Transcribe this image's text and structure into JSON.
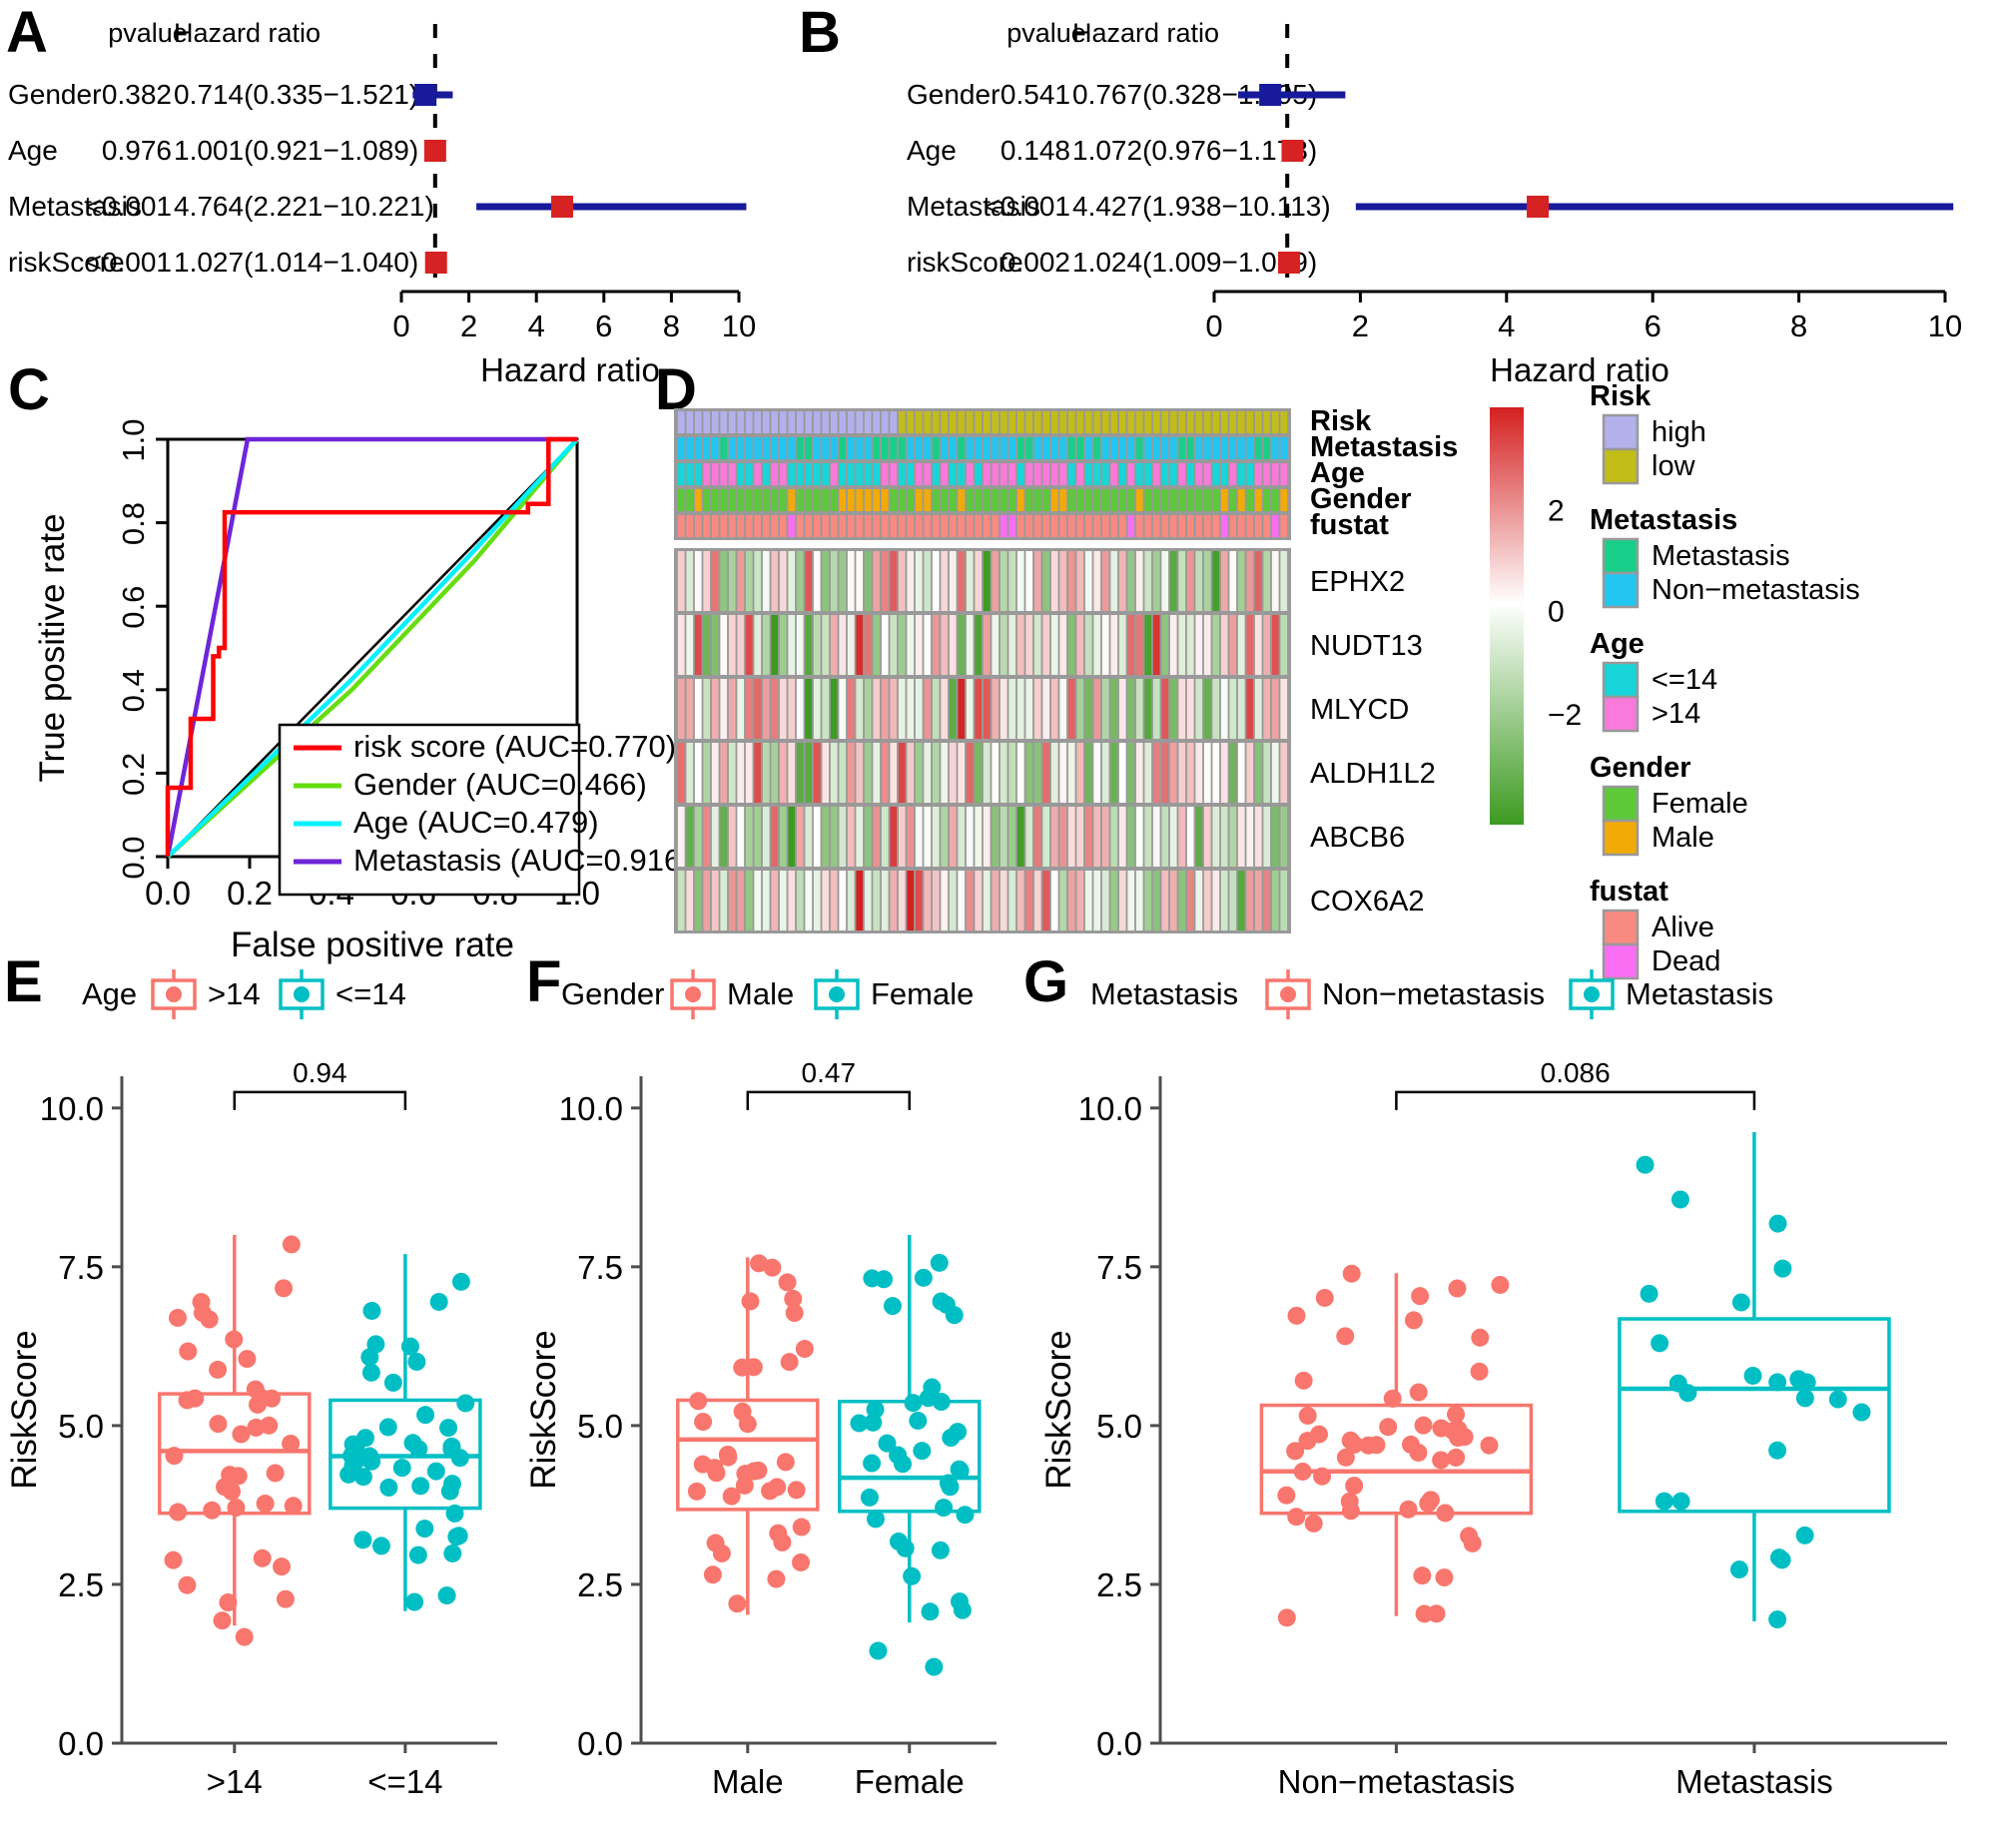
{
  "panels": {
    "A": {
      "label": "A"
    },
    "B": {
      "label": "B"
    },
    "C": {
      "label": "C"
    },
    "D": {
      "label": "D"
    },
    "E": {
      "label": "E"
    },
    "F": {
      "label": "F"
    },
    "G": {
      "label": "G"
    }
  },
  "forest": {
    "headers": {
      "pvalue": "pvalue",
      "hr": "Hazard ratio"
    },
    "axis_title": "Hazard ratio",
    "ticks": [
      "0",
      "2",
      "4",
      "6",
      "8",
      "10"
    ],
    "colors": {
      "red": "#d62222",
      "blue": "#181a9c",
      "dashed": "#000000"
    },
    "A": {
      "rows": [
        {
          "name": "Gender",
          "pvalue": "0.382",
          "hr": "0.714(0.335−1.521)",
          "est": 0.714,
          "lo": 0.335,
          "hi": 1.521,
          "box": "blue"
        },
        {
          "name": "Age",
          "pvalue": "0.976",
          "hr": "1.001(0.921−1.089)",
          "est": 1.001,
          "lo": 0.921,
          "hi": 1.089,
          "box": "red"
        },
        {
          "name": "Metastasis",
          "pvalue": "<0.001",
          "hr": "4.764(2.221−10.221)",
          "est": 4.764,
          "lo": 2.221,
          "hi": 10.221,
          "box": "red"
        },
        {
          "name": "riskScore",
          "pvalue": "<0.001",
          "hr": "1.027(1.014−1.040)",
          "est": 1.027,
          "lo": 1.014,
          "hi": 1.04,
          "box": "red"
        }
      ]
    },
    "B": {
      "rows": [
        {
          "name": "Gender",
          "pvalue": "0.541",
          "hr": "0.767(0.328−1.795)",
          "est": 0.767,
          "lo": 0.328,
          "hi": 1.795,
          "box": "blue"
        },
        {
          "name": "Age",
          "pvalue": "0.148",
          "hr": "1.072(0.976−1.178)",
          "est": 1.072,
          "lo": 0.976,
          "hi": 1.178,
          "box": "red"
        },
        {
          "name": "Metastasis",
          "pvalue": "<0.001",
          "hr": "4.427(1.938−10.113)",
          "est": 4.427,
          "lo": 1.938,
          "hi": 10.113,
          "box": "red"
        },
        {
          "name": "riskScore",
          "pvalue": "0.002",
          "hr": "1.024(1.009−1.039)",
          "est": 1.024,
          "lo": 1.009,
          "hi": 1.039,
          "box": "red"
        }
      ]
    }
  },
  "chart_data": [
    {
      "type": "line",
      "panel": "C",
      "title": "",
      "xlabel": "False positive rate",
      "ylabel": "True positive rate",
      "xlim": [
        0,
        1
      ],
      "ylim": [
        0,
        1
      ],
      "xticks": [
        "0.0",
        "0.2",
        "0.4",
        "0.6",
        "0.8",
        "1.0"
      ],
      "yticks": [
        "0.0",
        "0.2",
        "0.4",
        "0.6",
        "0.8",
        "1.0"
      ],
      "grid": false,
      "legend_position": "bottom-right",
      "series": [
        {
          "name": "risk score (AUC=0.770)",
          "color": "#ff0000",
          "auc": 0.77,
          "x": [
            0,
            0,
            0.028,
            0.028,
            0.056,
            0.056,
            0.111,
            0.111,
            0.125,
            0.125,
            0.139,
            0.139,
            0.88,
            0.88,
            0.93,
            0.93,
            1.0
          ],
          "y": [
            0,
            0.165,
            0.165,
            0.165,
            0.165,
            0.33,
            0.33,
            0.48,
            0.48,
            0.5,
            0.5,
            0.825,
            0.825,
            0.845,
            0.845,
            1.0,
            1.0
          ]
        },
        {
          "name": "Gender (AUC=0.466)",
          "color": "#66dd11",
          "auc": 0.466,
          "x": [
            0,
            0.45,
            0.75,
            1.0
          ],
          "y": [
            0,
            0.4,
            0.71,
            1.0
          ]
        },
        {
          "name": "Age (AUC=0.479)",
          "color": "#00f2ff",
          "auc": 0.479,
          "x": [
            0,
            0.45,
            0.75,
            1.0
          ],
          "y": [
            0,
            0.425,
            0.735,
            1.0
          ]
        },
        {
          "name": "Metastasis (AUC=0.916)",
          "color": "#6d26d8",
          "auc": 0.916,
          "x": [
            0,
            0.195,
            0.195,
            1.0
          ],
          "y": [
            0,
            1.0,
            1.0,
            1.0
          ]
        },
        {
          "name": "reference",
          "color": "#000000",
          "auc": 0.5,
          "x": [
            0,
            1.0
          ],
          "y": [
            0,
            1.0
          ]
        }
      ]
    },
    {
      "type": "heatmap",
      "panel": "D",
      "n_samples": 72,
      "split_index": 26,
      "genes": [
        "EPHX2",
        "NUDT13",
        "MLYCD",
        "ALDH1L2",
        "ABCB6",
        "COX6A2"
      ],
      "annotation_rows": [
        "Risk",
        "Metastasis",
        "Age",
        "Gender",
        "fustat"
      ],
      "colorbar": {
        "ticks": [
          "2",
          "0",
          "−2"
        ],
        "high": "#d42020",
        "mid": "#ffffff",
        "low": "#3d9a22"
      },
      "legends": [
        {
          "title": "Risk",
          "items": [
            {
              "label": "high",
              "color": "#b3b0ec"
            },
            {
              "label": "low",
              "color": "#c2bd19"
            }
          ]
        },
        {
          "title": "Metastasis",
          "items": [
            {
              "label": "Metastasis",
              "color": "#18cf8a"
            },
            {
              "label": "Non−metastasis",
              "color": "#22c6f0"
            }
          ]
        },
        {
          "title": "Age",
          "items": [
            {
              "label": "<=14",
              "color": "#17d5d8"
            },
            {
              "label": ">14",
              "color": "#f97ada"
            }
          ]
        },
        {
          "title": "Gender",
          "items": [
            {
              "label": "Female",
              "color": "#5cc83a"
            },
            {
              "label": "Male",
              "color": "#f2ab06"
            }
          ]
        },
        {
          "title": "fustat",
          "items": [
            {
              "label": "Alive",
              "color": "#f98a82"
            },
            {
              "label": "Dead",
              "color": "#f96ef3"
            }
          ]
        }
      ]
    },
    {
      "type": "boxplot",
      "panel": "E",
      "ylabel": "RiskScore",
      "legend_title": "Age",
      "pvalue": "0.94",
      "ylim": [
        0,
        10.5
      ],
      "yticks": [
        "0.0",
        "2.5",
        "5.0",
        "7.5",
        "10.0"
      ],
      "groups": [
        {
          "label": ">14",
          "color": "#f8766d",
          "q1": 3.62,
          "median": 4.6,
          "q3": 5.5,
          "lo": 1.85,
          "hi": 8.0
        },
        {
          "label": "<=14",
          "color": "#00bfc4",
          "q1": 3.7,
          "median": 4.52,
          "q3": 5.4,
          "lo": 2.08,
          "hi": 7.7
        }
      ]
    },
    {
      "type": "boxplot",
      "panel": "F",
      "ylabel": "RiskScore",
      "legend_title": "Gender",
      "pvalue": "0.47",
      "ylim": [
        0,
        10.5
      ],
      "yticks": [
        "0.0",
        "2.5",
        "5.0",
        "7.5",
        "10.0"
      ],
      "groups": [
        {
          "label": "Male",
          "color": "#f8766d",
          "q1": 3.68,
          "median": 4.78,
          "q3": 5.4,
          "lo": 2.02,
          "hi": 7.65
        },
        {
          "label": "Female",
          "color": "#00bfc4",
          "q1": 3.65,
          "median": 4.18,
          "q3": 5.38,
          "lo": 1.9,
          "hi": 8.0
        }
      ]
    },
    {
      "type": "boxplot",
      "panel": "G",
      "ylabel": "RiskScore",
      "legend_title": "Metastasis",
      "pvalue": "0.086",
      "ylim": [
        0,
        10.5
      ],
      "yticks": [
        "0.0",
        "2.5",
        "5.0",
        "7.5",
        "10.0"
      ],
      "groups": [
        {
          "label": "Non−metastasis",
          "color": "#f8766d",
          "q1": 3.62,
          "median": 4.28,
          "q3": 5.32,
          "lo": 2.0,
          "hi": 7.4
        },
        {
          "label": "Metastasis",
          "color": "#00bfc4",
          "q1": 3.65,
          "median": 5.58,
          "q3": 6.68,
          "lo": 1.92,
          "hi": 9.62
        }
      ]
    }
  ]
}
